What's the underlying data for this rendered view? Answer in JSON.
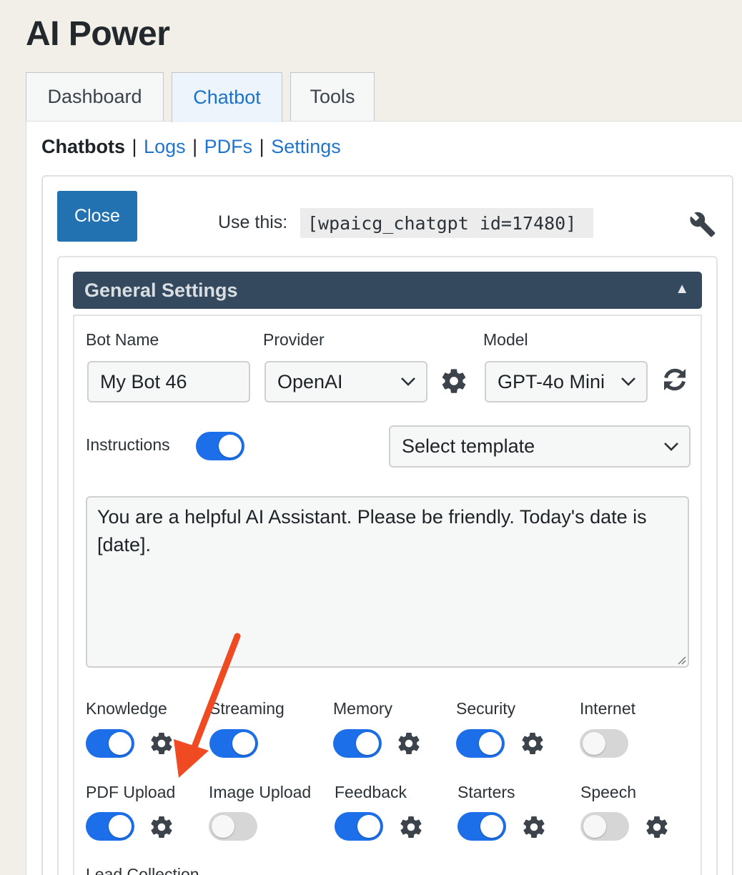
{
  "app": {
    "title": "AI Power"
  },
  "tabs": [
    {
      "label": "Dashboard",
      "active": false
    },
    {
      "label": "Chatbot",
      "active": true
    },
    {
      "label": "Tools",
      "active": false
    }
  ],
  "subnav": {
    "current": "Chatbots",
    "links": [
      "Logs",
      "PDFs",
      "Settings"
    ],
    "separator": "|"
  },
  "toolbar": {
    "close_label": "Close",
    "use_label": "Use this:",
    "shortcode": "[wpaicg_chatgpt id=17480]",
    "settings_icon": "wrench-icon"
  },
  "general_settings": {
    "header": "General Settings",
    "caret": "▲",
    "bot_name": {
      "label": "Bot Name",
      "value": "My Bot 46"
    },
    "provider": {
      "label": "Provider",
      "value": "OpenAI"
    },
    "model": {
      "label": "Model",
      "value": "GPT-4o Mini"
    },
    "instructions": {
      "label": "Instructions",
      "enabled": true,
      "template_placeholder": "Select template",
      "text": "You are a helpful AI Assistant. Please be friendly. Today's date is [date]."
    },
    "features_row1": [
      {
        "label": "Knowledge",
        "enabled": true,
        "has_settings": true
      },
      {
        "label": "Streaming",
        "enabled": true,
        "has_settings": false
      },
      {
        "label": "Memory",
        "enabled": true,
        "has_settings": true
      },
      {
        "label": "Security",
        "enabled": true,
        "has_settings": true
      },
      {
        "label": "Internet",
        "enabled": false,
        "has_settings": false
      }
    ],
    "features_row2": [
      {
        "label": "PDF Upload",
        "enabled": true,
        "has_settings": true
      },
      {
        "label": "Image Upload",
        "enabled": false,
        "has_settings": false
      },
      {
        "label": "Feedback",
        "enabled": true,
        "has_settings": true
      },
      {
        "label": "Starters",
        "enabled": true,
        "has_settings": true
      },
      {
        "label": "Speech",
        "enabled": false,
        "has_settings": true
      }
    ],
    "features_row3": [
      {
        "label": "Lead Collection"
      }
    ]
  },
  "annotation": {
    "arrow_color": "#f04a23"
  },
  "colors": {
    "accent": "#1c6fe8",
    "link": "#1f75cb",
    "header_bg": "#34495e",
    "button_bg": "#2271b1"
  }
}
